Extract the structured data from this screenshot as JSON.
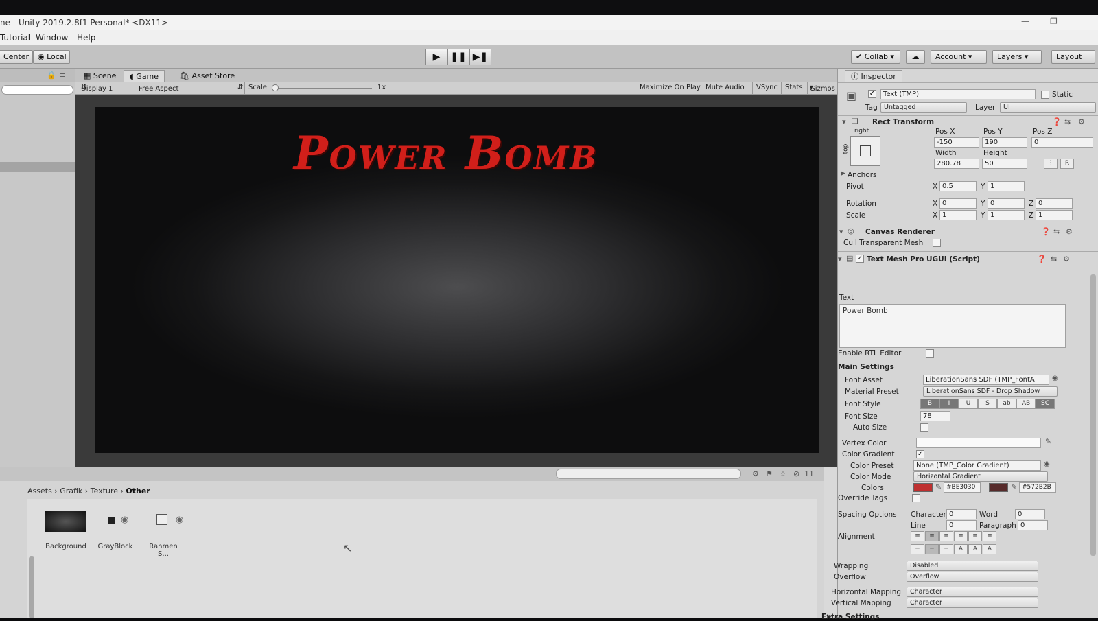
{
  "window": {
    "title": "ne - Unity 2019.2.8f1 Personal* <DX11>",
    "menu": [
      "Tutorial",
      "Window",
      "Help"
    ]
  },
  "toolbar": {
    "pivot_center": "Center",
    "pivot_local": "Local",
    "collab": "Collab",
    "account": "Account",
    "layers": "Layers",
    "layout": "Layout"
  },
  "hierarchy": {},
  "scene_tabs": [
    {
      "label": "Scene",
      "icon": "grid-icon"
    },
    {
      "label": "Game",
      "icon": "pacman-icon"
    },
    {
      "label": "Asset Store",
      "icon": "bag-icon"
    }
  ],
  "game_bar": {
    "display": "Display 1",
    "aspect": "Free Aspect",
    "scale_label": "Scale",
    "scale_value": "1x",
    "maximize": "Maximize On Play",
    "mute": "Mute Audio",
    "vsync": "VSync",
    "stats": "Stats",
    "gizmos": "Gizmos"
  },
  "game_view": {
    "title_text": "Power Bomb",
    "title_color": "#d11f1a"
  },
  "project": {
    "breadcrumbs": [
      "Assets",
      "Grafik",
      "Texture",
      "Other"
    ],
    "item_count": "11",
    "assets": [
      {
        "name": "Background"
      },
      {
        "name": "GrayBlock"
      },
      {
        "name": "Rahmen S..."
      }
    ]
  },
  "inspector": {
    "tab": "Inspector",
    "object_name": "Text (TMP)",
    "static_label": "Static",
    "tag_label": "Tag",
    "tag_value": "Untagged",
    "layer_label": "Layer",
    "layer_value": "UI",
    "rect_transform": {
      "header": "Rect Transform",
      "anchor_h": "right",
      "anchor_v": "top",
      "pos_x_label": "Pos X",
      "pos_x": "-150",
      "pos_y_label": "Pos Y",
      "pos_y": "190",
      "pos_z_label": "Pos Z",
      "pos_z": "0",
      "width_label": "Width",
      "width": "280.78",
      "height_label": "Height",
      "height": "50",
      "anchors_label": "Anchors",
      "pivot_label": "Pivot",
      "pivot_x": "0.5",
      "pivot_y": "1",
      "rotation_label": "Rotation",
      "rot_x": "0",
      "rot_y": "0",
      "rot_z": "0",
      "scale_label": "Scale",
      "scale_x": "1",
      "scale_y": "1",
      "scale_z": "1",
      "x": "X",
      "y": "Y",
      "z": "Z",
      "r_button": "R"
    },
    "canvas_renderer": {
      "header": "Canvas Renderer",
      "cull_label": "Cull Transparent Mesh"
    },
    "tmp": {
      "header": "Text Mesh Pro UGUI (Script)",
      "text_label": "Text",
      "text_value": "Power Bomb",
      "rtl_label": "Enable RTL Editor",
      "main_settings": "Main Settings",
      "font_asset_label": "Font Asset",
      "font_asset": "LiberationSans SDF (TMP_FontA",
      "material_preset_label": "Material Preset",
      "material_preset": "LiberationSans SDF - Drop Shadow",
      "font_style_label": "Font Style",
      "font_styles": [
        "B",
        "I",
        "U",
        "S",
        "ab",
        "AB",
        "SC"
      ],
      "font_size_label": "Font Size",
      "font_size": "78",
      "auto_size_label": "Auto Size",
      "vertex_color_label": "Vertex Color",
      "color_gradient_label": "Color Gradient",
      "color_preset_label": "Color Preset",
      "color_preset": "None (TMP_Color Gradient)",
      "color_mode_label": "Color Mode",
      "color_mode": "Horizontal Gradient",
      "colors_label": "Colors",
      "color1_hex": "#BE3030",
      "color2_hex": "#572B2B",
      "override_tags_label": "Override Tags",
      "spacing_label": "Spacing Options",
      "character_label": "Character",
      "character": "0",
      "word_label": "Word",
      "word": "0",
      "line_label": "Line",
      "line": "0",
      "paragraph_label": "Paragraph",
      "paragraph": "0",
      "alignment_label": "Alignment",
      "wrapping_label": "Wrapping",
      "wrapping": "Disabled",
      "overflow_label": "Overflow",
      "overflow": "Overflow",
      "hmap_label": "Horizontal Mapping",
      "hmap": "Character",
      "vmap_label": "Vertical Mapping",
      "vmap": "Character",
      "extra_settings": "Extra Settings"
    }
  }
}
